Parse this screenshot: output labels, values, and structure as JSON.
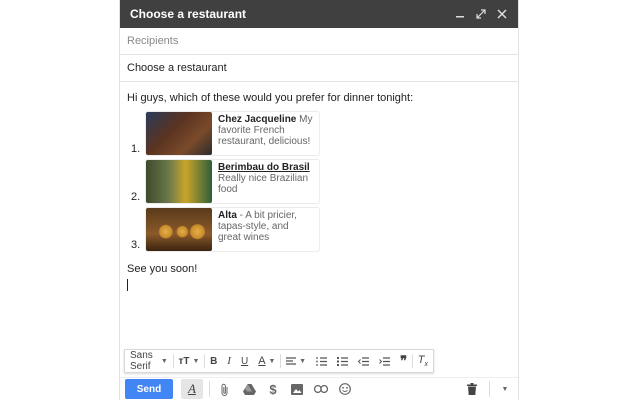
{
  "window": {
    "title": "Choose a restaurant"
  },
  "fields": {
    "recipients_placeholder": "Recipients",
    "subject": "Choose a restaurant"
  },
  "body": {
    "greeting": "Hi guys, which of these would you prefer for dinner tonight:",
    "items": [
      {
        "number": "1.",
        "name": "Chez Jacqueline",
        "description": " My favorite French restaurant, delicious!",
        "thumb_color": "#3b2a24"
      },
      {
        "number": "2.",
        "name": "Berimbau do Brasil",
        "description": " Really nice Brazilian food",
        "thumb_color": "#556b3a"
      },
      {
        "number": "3.",
        "name": "Alta",
        "description": " - A bit pricier, tapas-style, and great wines",
        "thumb_color": "#9a6b2a"
      }
    ],
    "signoff": "See you soon!"
  },
  "format_toolbar": {
    "font": "Sans Serif",
    "size_icon": "text-size-icon"
  },
  "bottom_toolbar": {
    "send_label": "Send"
  },
  "colors": {
    "titlebar": "#404040",
    "send": "#4285f4"
  }
}
